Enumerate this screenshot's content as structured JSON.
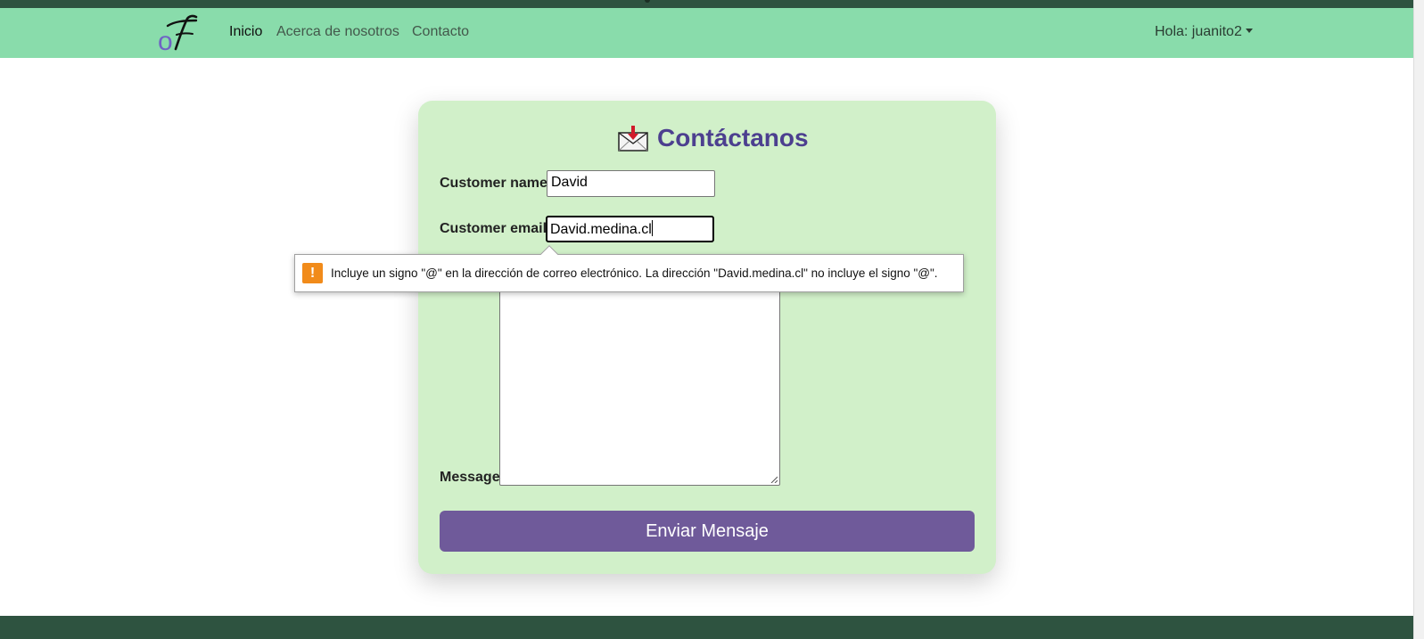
{
  "navbar": {
    "brand_icon": "fa-signature-logo",
    "links": [
      {
        "label": "Inicio",
        "active": true
      },
      {
        "label": "Acerca de nosotros",
        "active": false
      },
      {
        "label": "Contacto",
        "active": false
      }
    ],
    "user_menu": "Hola: juanito2"
  },
  "contact": {
    "title": "Contáctanos",
    "title_icon": "envelope-download-icon",
    "name_label": "Customer name",
    "name_value": "David",
    "email_label": "Customer email",
    "email_value": "David.medina.cl",
    "message_label": "Message",
    "message_value": "",
    "submit_label": "Enviar Mensaje"
  },
  "validation_tooltip": {
    "icon": "warning-icon",
    "text": "Incluye un signo \"@\" en la dirección de correo electrónico. La dirección \"David.medina.cl\" no incluye el signo \"@\"."
  },
  "colors": {
    "navbar": "#89dcab",
    "footer": "#2e5340",
    "card": "#d1f0c9",
    "title": "#4c3f8f",
    "button": "#6f5a9a",
    "warning": "#f18b1a"
  }
}
